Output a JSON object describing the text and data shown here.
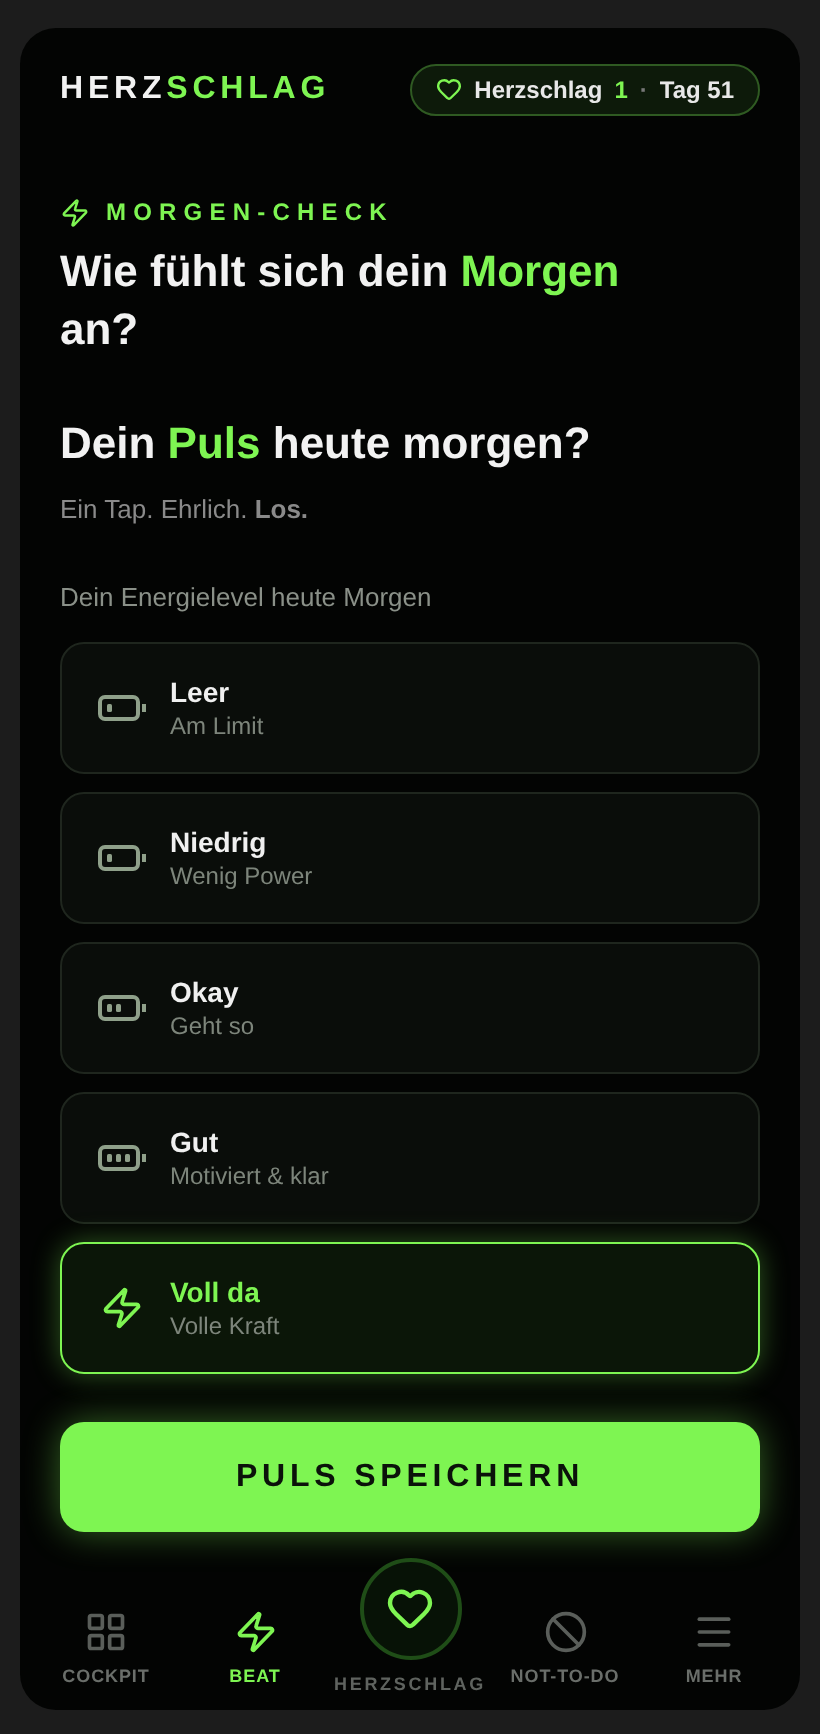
{
  "header": {
    "brand_left": "HERZ",
    "brand_right": "SCHLAG",
    "badge": {
      "label": "Herzschlag",
      "count": "1",
      "separator": "·",
      "day": "Tag 51"
    }
  },
  "eyebrow": "MORGEN-CHECK",
  "title": {
    "before": "Wie fühlt sich dein ",
    "accent": "Morgen",
    "after": " an?"
  },
  "question": {
    "before": "Dein ",
    "accent": "Puls",
    "after": " heute morgen?"
  },
  "subtitle": "Ein Tap. Ehrlich. **Los.**",
  "energy_label": "Dein Energielevel heute Morgen",
  "options": [
    {
      "kind": "empty",
      "title": "Leer",
      "subtitle": "Am Limit",
      "selected": false
    },
    {
      "kind": "low",
      "title": "Niedrig",
      "subtitle": "Wenig Power",
      "selected": false
    },
    {
      "kind": "medium",
      "title": "Okay",
      "subtitle": "Geht so",
      "selected": false
    },
    {
      "kind": "high",
      "title": "Gut",
      "subtitle": "Motiviert & klar",
      "selected": false
    },
    {
      "kind": "bolt",
      "title": "Voll da",
      "subtitle": "Volle Kraft",
      "selected": true
    }
  ],
  "save_button": "PULS SPEICHERN",
  "nav": [
    {
      "kind": "grid",
      "label": "COCKPIT",
      "selected": false
    },
    {
      "kind": "bolt",
      "label": "BEAT",
      "selected": true
    },
    {
      "kind": "heart",
      "label": "HERZSCHLAG",
      "selected": false
    },
    {
      "kind": "ban",
      "label": "NOT-TO-DO",
      "selected": false
    },
    {
      "kind": "menu",
      "label": "MEHR",
      "selected": false
    }
  ]
}
